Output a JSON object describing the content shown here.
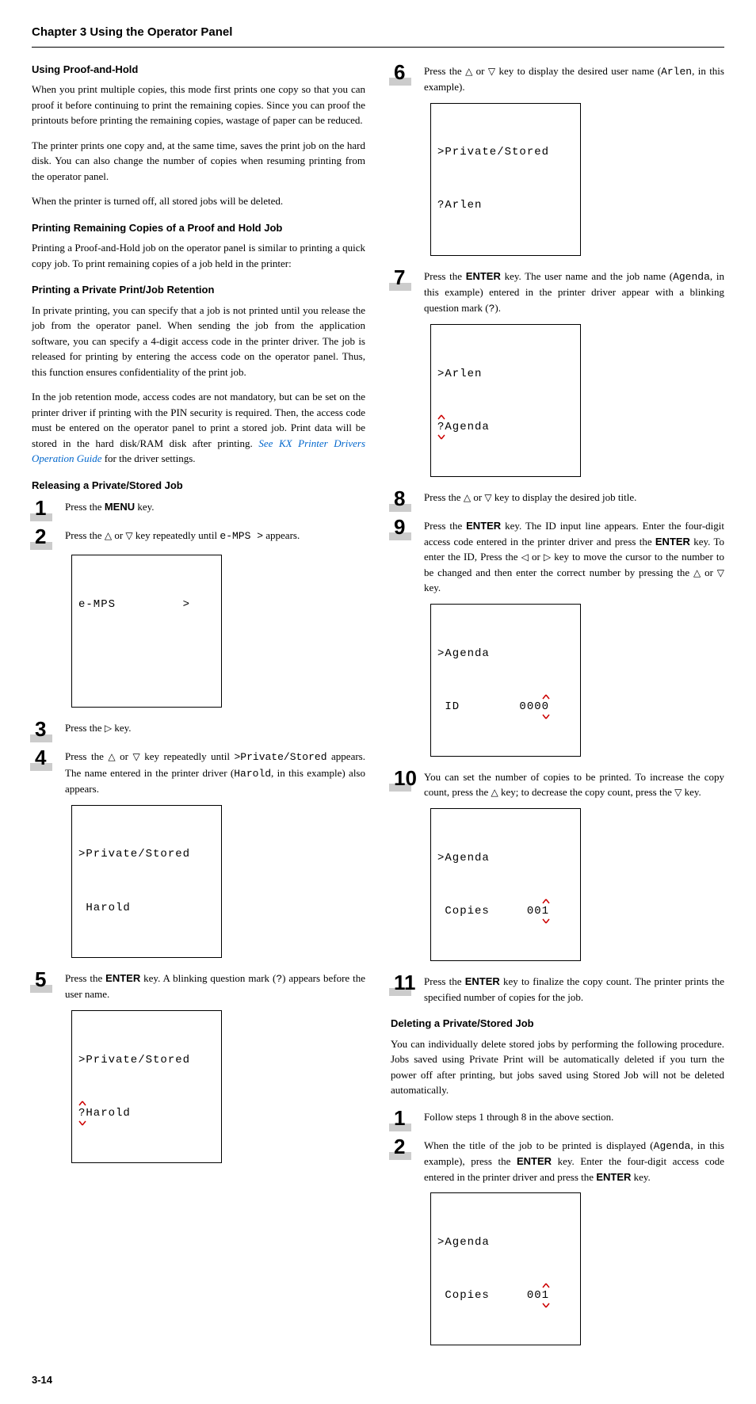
{
  "chapter": "Chapter 3  Using the Operator Panel",
  "left": {
    "h1": "Using Proof-and-Hold",
    "p1": "When you print multiple copies, this mode first prints one copy so that you can proof it before continuing to print the remaining copies. Since you can proof the printouts before printing the remaining copies, wastage of paper can be reduced.",
    "p2": "The printer prints one copy and, at the same time, saves the print job on the hard disk. You can also change the number of copies when resuming printing from the operator panel.",
    "p3": "When the printer is turned off, all stored jobs will be deleted.",
    "h2": "Printing Remaining Copies of a Proof and Hold Job",
    "p4": "Printing a Proof-and-Hold job on the operator panel is similar to printing a quick copy job. To print remaining copies of a job held in the printer:",
    "h3": "Printing a Private Print/Job Retention",
    "p5": "In private printing, you can specify that a job is not printed until you release the job from the operator panel. When sending the job from the application software, you can specify a 4-digit access code in the printer driver. The job is released for printing by entering the access code on the operator panel. Thus, this function ensures confidentiality of the print job.",
    "p6a": "In the job retention mode, access codes are not mandatory, but can be set on the printer driver if printing with the PIN security is required. Then, the access code must be entered on the operator panel to print a stored job. Print data will be stored in the hard disk/RAM disk after printing. ",
    "p6link": "See KX Printer Drivers Operation Guide",
    "p6b": " for the driver settings.",
    "h4": "Releasing a Private/Stored Job",
    "s1a": "Press the ",
    "s1b": "MENU",
    "s1c": " key.",
    "s2a": "Press the ",
    "s2b": " or ",
    "s2c": " key repeatedly until ",
    "s2mono": "e-MPS  >",
    "s2d": " appears.",
    "lcd1": "e-MPS         >",
    "s3a": "Press the ",
    "s3b": " key.",
    "s4a": "Press the ",
    "s4b": " or ",
    "s4c": " key repeatedly until ",
    "s4mono": ">Private/Stored",
    "s4d": " appears. The name entered in the printer driver (",
    "s4mono2": "Harold",
    "s4e": ", in this example) also appears.",
    "lcd2a": ">Private/Stored",
    "lcd2b": " Harold",
    "s5a": "Press the ",
    "s5b": "ENTER",
    "s5c": " key. A blinking question mark (",
    "s5mono": "?",
    "s5d": ") appears before the user name.",
    "lcd3a": ">Private/Stored",
    "lcd3b": "?Harold"
  },
  "right": {
    "s6a": "Press the ",
    "s6b": " or ",
    "s6c": " key to display the desired user name (",
    "s6mono": "Arlen",
    "s6d": ", in this example).",
    "lcd4a": ">Private/Stored",
    "lcd4b": "?Arlen",
    "s7a": "Press the ",
    "s7b": "ENTER",
    "s7c": " key. The user name and the job name (",
    "s7mono": "Agenda",
    "s7d": ", in this example) entered in the printer driver appear with a blinking question mark (",
    "s7mono2": "?",
    "s7e": ").",
    "lcd5a": ">Arlen",
    "lcd5b": "?Agenda",
    "s8a": "Press the ",
    "s8b": " or ",
    "s8c": " key to display the desired job title.",
    "s9a": "Press the ",
    "s9b": "ENTER",
    "s9c": " key. The ID input line appears. Enter the four-digit access code entered in the printer driver and press the ",
    "s9d": "ENTER",
    "s9e": " key. To enter the ID, Press the ",
    "s9f": " or ",
    "s9g": " key to move the cursor to the number to be changed and then enter the correct number by pressing the ",
    "s9h": " or ",
    "s9i": " key.",
    "lcd6a": ">Agenda",
    "lcd6b": " ID        000",
    "lcd6c": "0",
    "s10a": "You can set the number of copies to be printed. To increase the copy count, press the ",
    "s10b": " key; to decrease the copy count, press the ",
    "s10c": " key.",
    "lcd7a": ">Agenda",
    "lcd7b": " Copies     00",
    "lcd7c": "1",
    "s11a": "Press the ",
    "s11b": "ENTER",
    "s11c": " key to finalize the copy count. The printer prints the specified number of copies for the job.",
    "h5": "Deleting a Private/Stored Job",
    "p7": "You can individually delete stored jobs by performing the following procedure. Jobs saved using Private Print will be automatically deleted if you turn the power off after printing, but jobs saved using Stored Job will not be deleted automatically.",
    "sd1": "Follow steps 1 through 8 in the above section.",
    "sd2a": "When the title of the job to be printed is displayed (",
    "sd2mono": "Agenda",
    "sd2b": ", in this example), press the ",
    "sd2c": "ENTER",
    "sd2d": " key. Enter the four-digit access code entered in the printer driver and press the ",
    "sd2e": "ENTER",
    "sd2f": " key.",
    "lcd8a": ">Agenda",
    "lcd8b": " Copies     00",
    "lcd8c": "1"
  },
  "pagenum": "3-14",
  "glyph": {
    "up": "△",
    "down": "▽",
    "left": "◁",
    "right": "▷"
  }
}
